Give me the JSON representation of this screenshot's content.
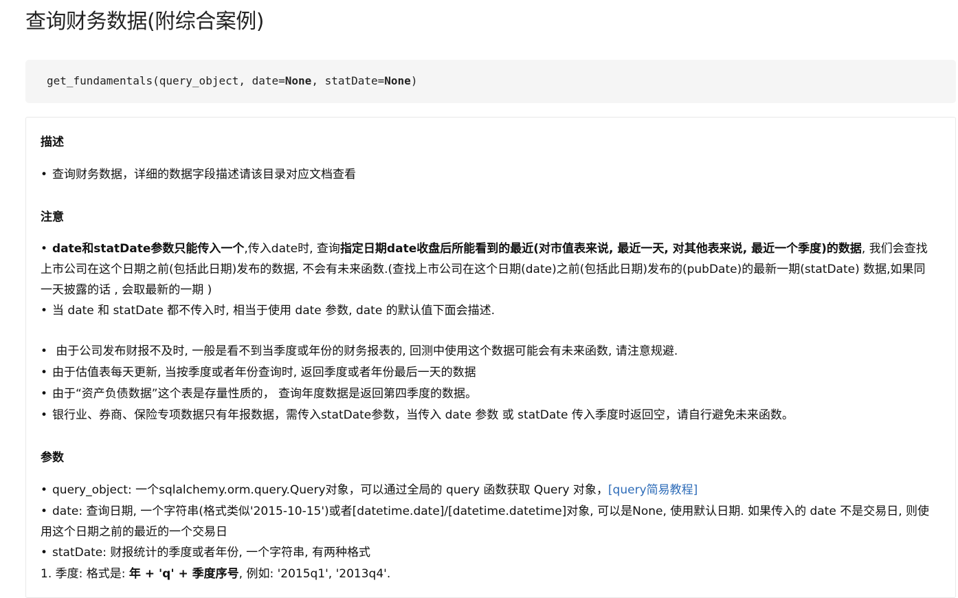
{
  "title": "查询财务数据(附综合案例)",
  "code": {
    "prefix": "get_fundamentals(query_object, date=",
    "kw1": "None",
    "middle": ", statDate=",
    "kw2": "None",
    "suffix": ")"
  },
  "description": {
    "heading": "描述",
    "bullet1": "查询财务数据，详细的数据字段描述请该目录对应文档查看"
  },
  "notice": {
    "heading": "注意",
    "n1_bold1": "date和statDate参数只能传入一个",
    "n1_text1": ",传入date时, 查询",
    "n1_bold2": "指定日期date收盘后所能看到的最近(对市值表来说, 最近一天, 对其他表来说, 最近一个季度)的数据",
    "n1_text2": ", 我们会查找上市公司在这个日期之前(包括此日期)发布的数据, 不会有未来函数.(查找上市公司在这个日期(date)之前(包括此日期)发布的(pubDate)的最新一期(statDate) 数据,如果同一天披露的话 , 会取最新的一期 )",
    "n2": "当 date 和 statDate 都不传入时, 相当于使用 date 参数, date 的默认值下面会描述.",
    "n3": " 由于公司发布财报不及时, 一般是看不到当季度或年份的财务报表的, 回测中使用这个数据可能会有未来函数, 请注意规避.",
    "n4": "由于估值表每天更新, 当按季度或者年份查询时, 返回季度或者年份最后一天的数据",
    "n5": "由于“资产负债数据”这个表是存量性质的， 查询年度数据是返回第四季度的数据。",
    "n6": "银行业、券商、保险专项数据只有年报数据，需传入statDate参数，当传入 date 参数 或 statDate 传入季度时返回空，请自行避免未来函数。"
  },
  "params": {
    "heading": "参数",
    "p1_text": "query_object: 一个sqlalchemy.orm.query.Query对象，可以通过全局的 query 函数获取 Query 对象，",
    "p1_link": "[query简易教程]",
    "p2": "date: 查询日期, 一个字符串(格式类似'2015-10-15')或者[datetime.date]/[datetime.datetime]对象, 可以是None, 使用默认日期. 如果传入的 date 不是交易日, 则使用这个日期之前的最近的一个交易日",
    "p3": "statDate: 财报统计的季度或者年份, 一个字符串, 有两种格式",
    "p4_text1": "1. 季度: 格式是: ",
    "p4_bold": "年 + 'q' + 季度序号",
    "p4_text2": ", 例如: '2015q1', '2013q4'."
  }
}
